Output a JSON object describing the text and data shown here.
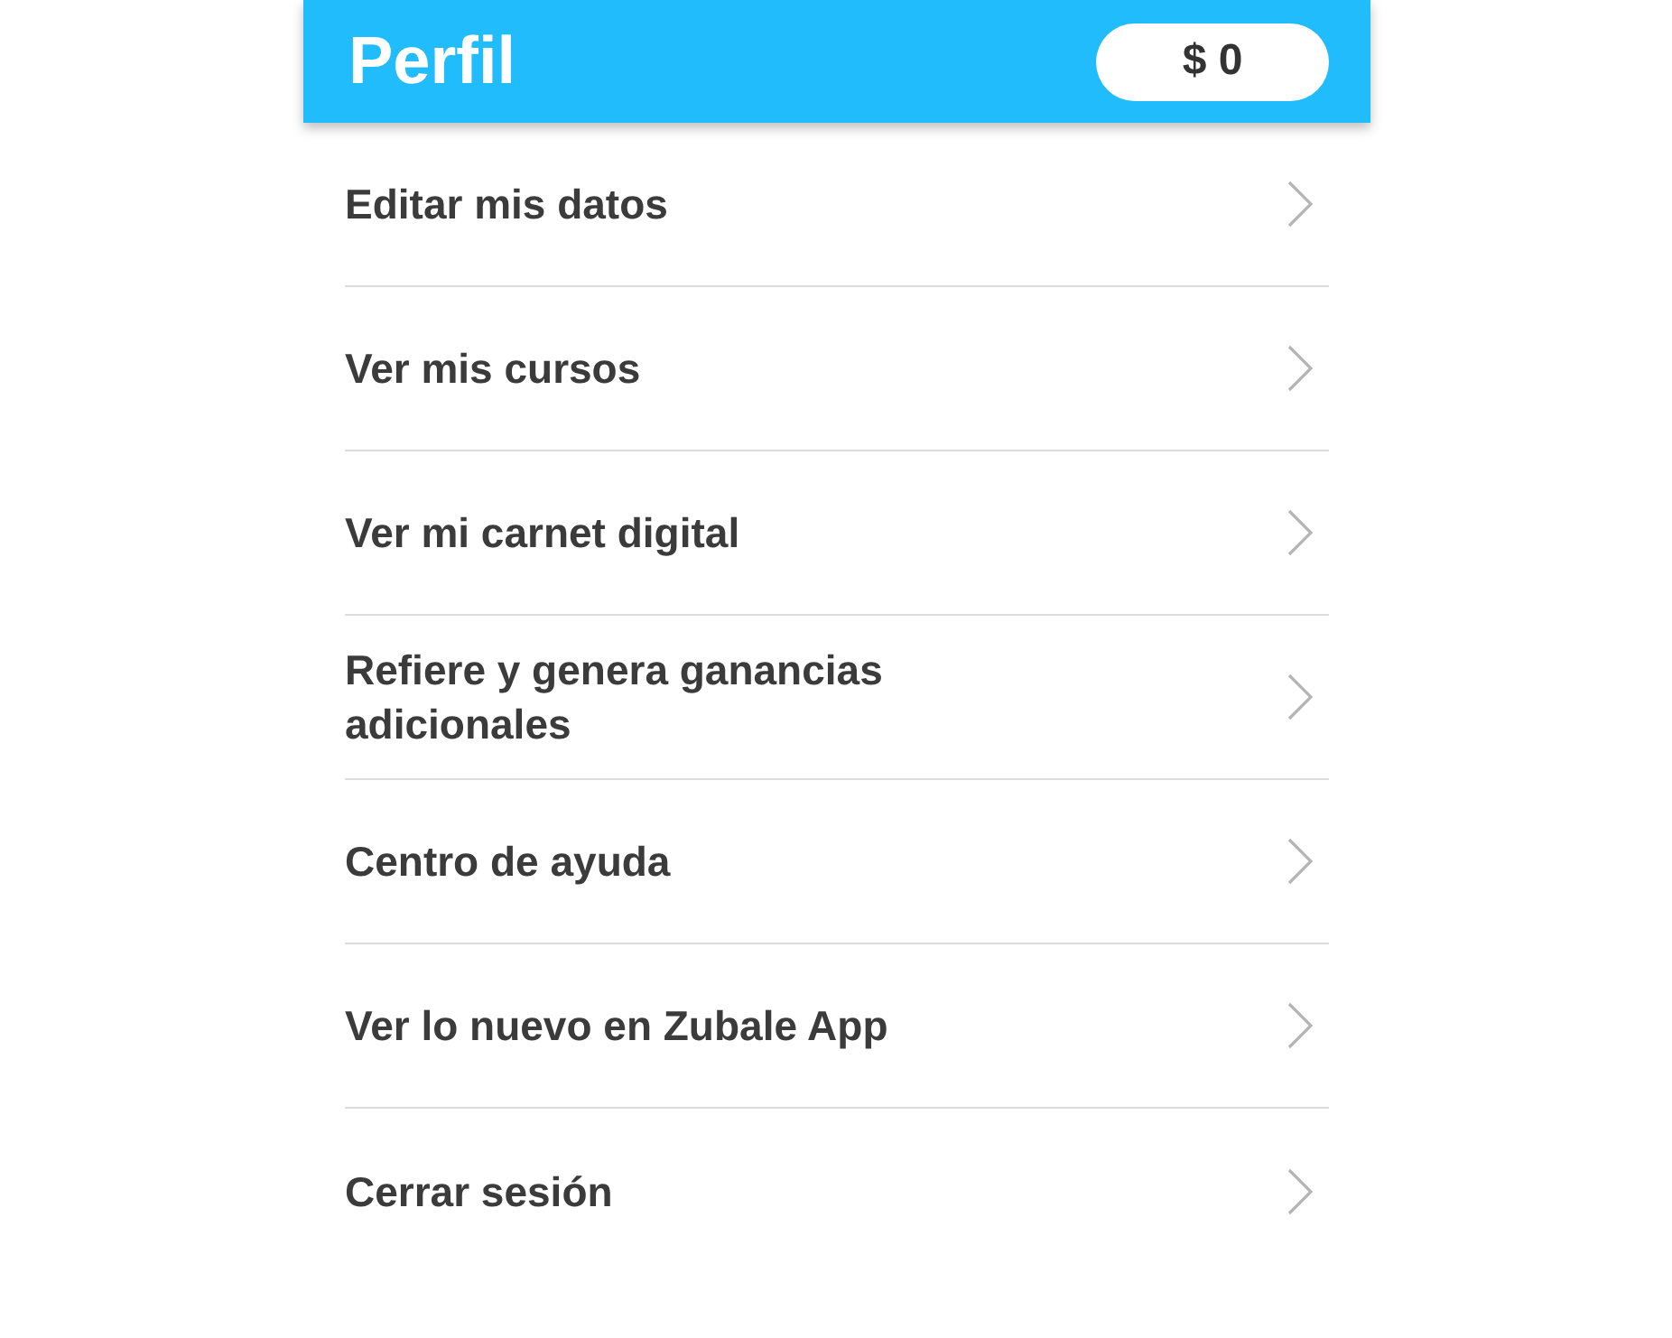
{
  "header": {
    "title": "Perfil",
    "balance": "$ 0"
  },
  "menu": [
    {
      "label": "Editar mis datos"
    },
    {
      "label": "Ver mis cursos"
    },
    {
      "label": "Ver mi carnet digital"
    },
    {
      "label": "Refiere y genera ganancias adicionales"
    },
    {
      "label": "Centro de ayuda"
    },
    {
      "label": "Ver lo nuevo en Zubale App"
    },
    {
      "label": "Cerrar sesión"
    }
  ]
}
